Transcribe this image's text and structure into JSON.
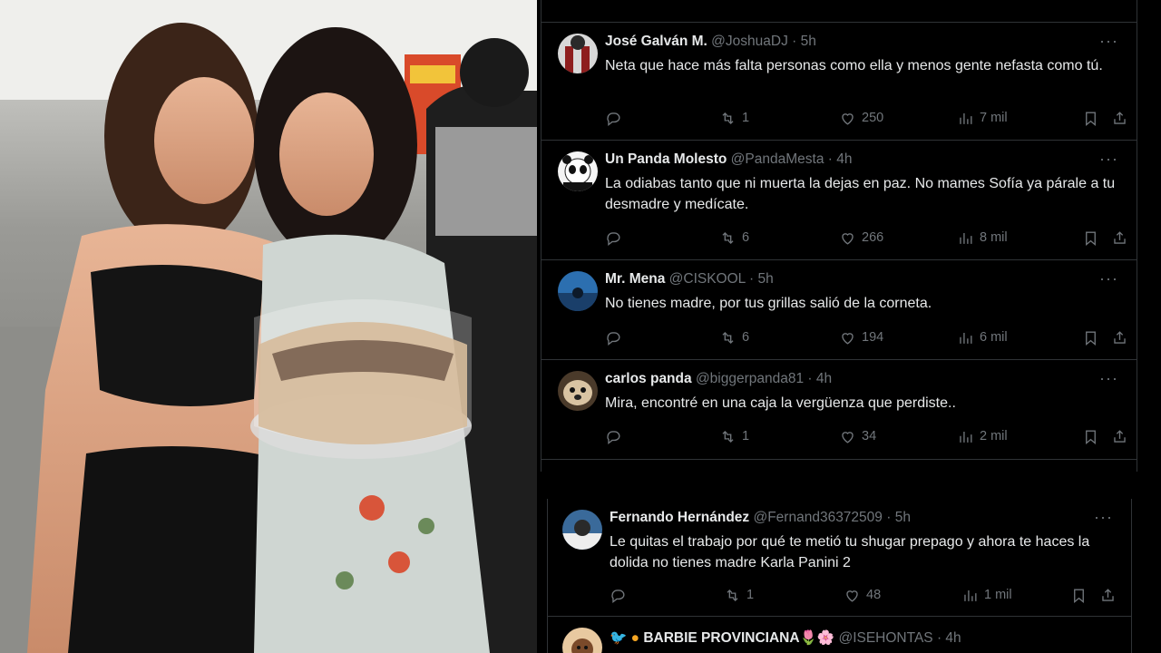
{
  "tweets": [
    {
      "name": "José Galván M.",
      "handle": "@JoshuaDJ",
      "time": "5h",
      "text": "Neta que hace más falta personas como ella y menos gente nefasta como tú.",
      "retweets": "1",
      "likes": "250",
      "views": "7 mil",
      "avatar_color": "#6b3030"
    },
    {
      "name": "Un Panda Molesto",
      "handle": "@PandaMesta",
      "time": "4h",
      "text": "La odiabas tanto que ni muerta la dejas en paz. No mames Sofía ya párale a tu desmadre y medícate.",
      "retweets": "6",
      "likes": "266",
      "views": "8 mil",
      "avatar_color": "#ffffff"
    },
    {
      "name": "Mr. Mena",
      "handle": "@CISKOOL",
      "time": "5h",
      "text": "No tienes madre, por tus grillas salió de la corneta.",
      "retweets": "6",
      "likes": "194",
      "views": "6 mil",
      "avatar_color": "#1e5b8c"
    },
    {
      "name": "carlos panda",
      "handle": "@biggerpanda81",
      "time": "4h",
      "text": "Mira, encontré en una caja la vergüenza que perdiste..",
      "retweets": "1",
      "likes": "34",
      "views": "2 mil",
      "avatar_color": "#b89e7a"
    },
    {
      "name": "Fernando Hernández",
      "handle": "@Fernand36372509",
      "time": "5h",
      "text": "Le quitas el trabajo por qué te metió tu shugar prepago y ahora te haces la dolida no tienes madre Karla Panini 2",
      "retweets": "1",
      "likes": "48",
      "views": "1 mil",
      "avatar_color": "#3a6a9a"
    },
    {
      "name": "BARBIE PROVINCIANA🌷🌸",
      "handle": "@ISEHONTAS",
      "time": "4h",
      "avatar_color": "#e8c9a0"
    }
  ],
  "dot": "·",
  "more": "···"
}
